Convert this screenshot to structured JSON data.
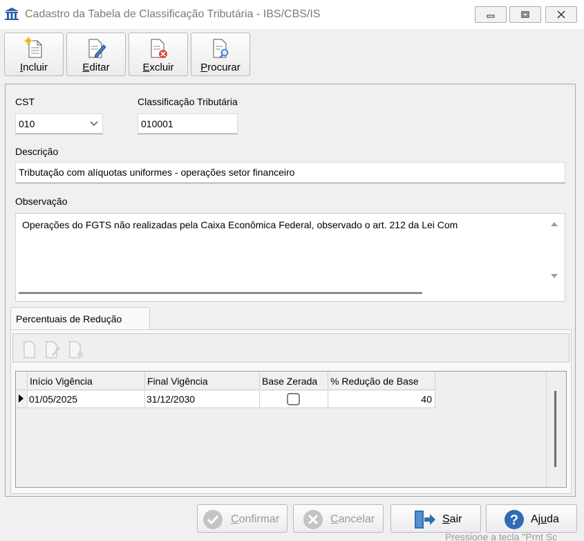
{
  "window": {
    "title": "Cadastro da Tabela de Classificação Tributária - IBS/CBS/IS"
  },
  "toolbar": {
    "incluir": {
      "first": "I",
      "rest": "ncluir"
    },
    "editar": {
      "first": "E",
      "rest": "ditar"
    },
    "excluir": {
      "first": "E",
      "rest": "xcluir"
    },
    "procurar": {
      "first": "P",
      "rest": "rocurar"
    }
  },
  "form": {
    "cst_label": "CST",
    "cst_value": "010",
    "classificacao_label": "Classificação Tributária",
    "classificacao_value": "010001",
    "descricao_label": "Descrição",
    "descricao_value": "Tributação com alíquotas uniformes - operações setor financeiro",
    "observacao_label": "Observação",
    "observacao_value": "Operações do FGTS não realizadas pela Caixa Econômica Federal, observado o art. 212 da Lei Com"
  },
  "tab": {
    "label": "Percentuais de Redução"
  },
  "grid": {
    "columns": [
      "Início Vigência",
      "Final Vigência",
      "Base Zerada",
      "% Redução de Base"
    ],
    "rows": [
      {
        "inicio": "01/05/2025",
        "final": "31/12/2030",
        "base_zerada": false,
        "reducao": "40"
      }
    ]
  },
  "footer": {
    "confirmar": {
      "first": "C",
      "rest": "onfirmar"
    },
    "cancelar": {
      "first": "C",
      "rest": "ancelar"
    },
    "sair": {
      "first": "S",
      "rest": "air"
    },
    "ajuda": {
      "pre": "Aj",
      "ul": "u",
      "post": "da"
    }
  },
  "status_hint": "Pressione a tecla \"Prnt Sc"
}
